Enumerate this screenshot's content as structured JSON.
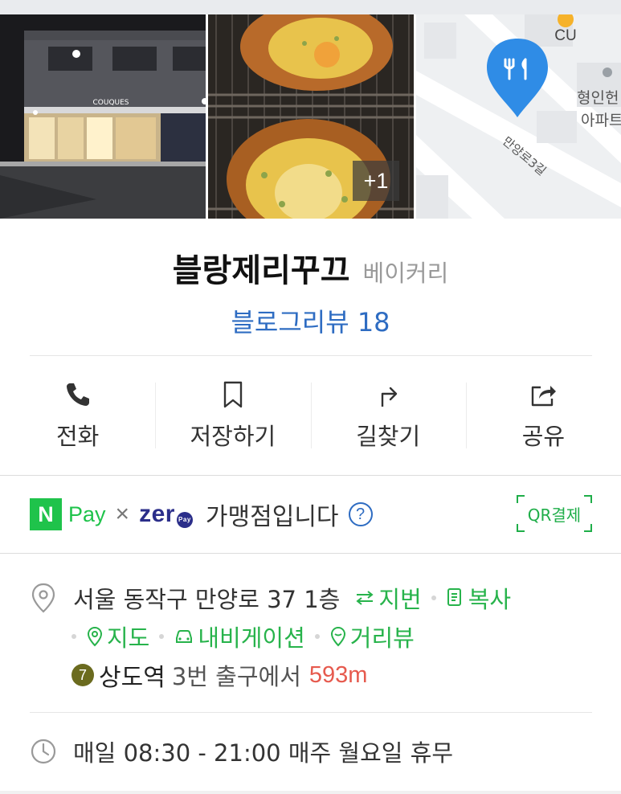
{
  "photos": {
    "more_count": "+1",
    "storefront_sign": "COUQUES",
    "map_labels": {
      "store": "CU",
      "building_line1": "형인헌",
      "building_line2": "아파트",
      "road": "만양로3길"
    }
  },
  "place": {
    "name": "블랑제리꾸끄",
    "category": "베이커리",
    "review_label": "블로그리뷰 18"
  },
  "actions": [
    {
      "label": "전화",
      "icon": "phone-icon"
    },
    {
      "label": "저장하기",
      "icon": "bookmark-icon"
    },
    {
      "label": "길찾기",
      "icon": "directions-icon"
    },
    {
      "label": "공유",
      "icon": "share-icon"
    }
  ],
  "payment": {
    "npay_logo_letter": "N",
    "npay_word": "Pay",
    "times": "×",
    "zero_word": "zer",
    "zero_pay_mark": "Pay",
    "text": "가맹점입니다",
    "help": "?",
    "qr_label": "QR결제"
  },
  "address": {
    "text": "서울 동작구 만양로 37 1층",
    "jibun": "지번",
    "copy": "복사",
    "map": "지도",
    "navigation": "내비게이션",
    "street_view": "거리뷰"
  },
  "subway": {
    "line_number": "7",
    "station": "상도역",
    "exit_text": "3번 출구에서",
    "distance": "593m",
    "line_color": "#6b6b1f"
  },
  "hours": {
    "text": "매일 08:30 - 21:00 매주 월요일 휴무"
  },
  "colors": {
    "accent_blue": "#2e6cc2",
    "accent_green": "#27b34b",
    "distance_red": "#e65a4e"
  }
}
